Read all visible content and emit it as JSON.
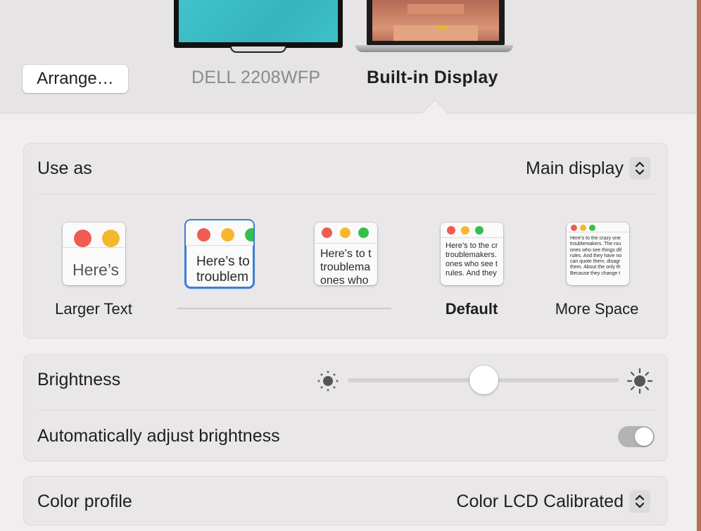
{
  "header": {
    "arrange_label": "Arrange…",
    "displays": [
      {
        "name": "DELL 2208WFP",
        "selected": false
      },
      {
        "name": "Built-in Display",
        "selected": true
      }
    ]
  },
  "use_as": {
    "label": "Use as",
    "value": "Main display"
  },
  "resolutions": {
    "sample_text": "Here’s to the crazy ones, the misfits, the rebels, the troublemakers. The round pegs in the square holes. The ones who see things differently. They’re not fond of rules. And they have no respect for the status quo. You can quote them, disagree with them, glorify or vilify them. About the only thing you can’t do is ignore them. Because they change things.",
    "options": [
      {
        "label": "Larger Text",
        "preview": "Here’s",
        "selected": false,
        "default": false
      },
      {
        "label": "",
        "preview": "Here’s to\ntroublem",
        "selected": true,
        "default": false
      },
      {
        "label": "",
        "preview": "Here’s to t\ntroublema\nones who",
        "selected": false,
        "default": false
      },
      {
        "label": "Default",
        "preview": "Here’s to the cr\ntroublemakers.\nones who see t\nrules. And they",
        "selected": false,
        "default": true
      },
      {
        "label": "More Space",
        "preview": "Here’s to the crazy one\ntroublemakers. The rou\nones who see things dif\nrules. And they have no\ncan quote them, disagr\nthem. About the only th\nBecause they change t",
        "selected": false,
        "default": false
      }
    ]
  },
  "brightness": {
    "label": "Brightness",
    "level": 0.5,
    "auto_label": "Automatically adjust brightness",
    "auto_enabled": true
  },
  "color_profile": {
    "label": "Color profile",
    "value": "Color LCD Calibrated"
  },
  "colors": {
    "close": "#ee5c52",
    "minimize": "#f5b82d",
    "zoom": "#35c04a",
    "accent": "#3b7fd6"
  }
}
